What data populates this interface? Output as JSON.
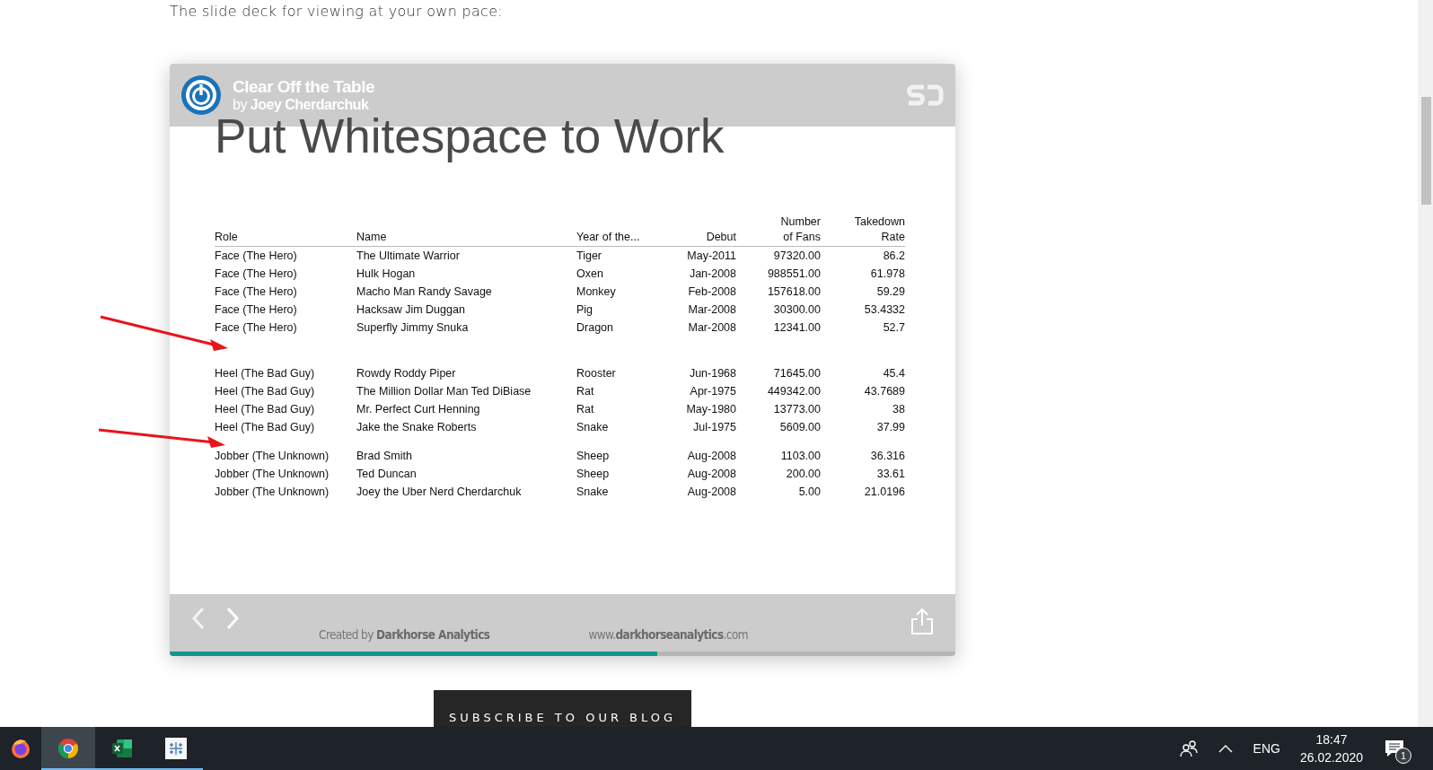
{
  "intro": "The slide deck for viewing at your own pace:",
  "slide_player": {
    "deck_title": "Clear Off the Table",
    "author_prefix": "by",
    "author": "Joey Cherdarchuk",
    "slide": {
      "title": "Put Whitespace to Work",
      "table": {
        "columns": [
          {
            "lines": [
              "Role"
            ],
            "kind": "text"
          },
          {
            "lines": [
              "Name"
            ],
            "kind": "text"
          },
          {
            "lines": [
              "Year of the..."
            ],
            "kind": "text"
          },
          {
            "lines": [
              "Debut"
            ],
            "kind": "number"
          },
          {
            "lines": [
              "Number",
              "of Fans"
            ],
            "kind": "number"
          },
          {
            "lines": [
              "Takedown",
              "Rate"
            ],
            "kind": "number"
          }
        ],
        "groups": [
          {
            "rows": [
              [
                "Face (The Hero)",
                "The Ultimate Warrior",
                "Tiger",
                "May-2011",
                "97320.00",
                "86.2"
              ],
              [
                "Face (The Hero)",
                "Hulk Hogan",
                "Oxen",
                "Jan-2008",
                "988551.00",
                "61.978"
              ],
              [
                "Face (The Hero)",
                "Macho Man Randy Savage",
                "Monkey",
                "Feb-2008",
                "157618.00",
                "59.29"
              ],
              [
                "Face (The Hero)",
                "Hacksaw Jim Duggan",
                "Pig",
                "Mar-2008",
                "30300.00",
                "53.4332"
              ],
              [
                "Face (The Hero)",
                "Superfly Jimmy Snuka",
                "Dragon",
                "Mar-2008",
                "12341.00",
                "52.7"
              ]
            ]
          },
          {
            "rows": [
              [
                "Heel (The Bad Guy)",
                "Rowdy Roddy Piper",
                "Rooster",
                "Jun-1968",
                "71645.00",
                "45.4"
              ],
              [
                "Heel (The Bad Guy)",
                "The Million Dollar Man Ted DiBiase",
                "Rat",
                "Apr-1975",
                "449342.00",
                "43.7689"
              ],
              [
                "Heel (The Bad Guy)",
                "Mr. Perfect Curt Henning",
                "Rat",
                "May-1980",
                "13773.00",
                "38"
              ],
              [
                "Heel (The Bad Guy)",
                "Jake the Snake Roberts",
                "Snake",
                "Jul-1975",
                "5609.00",
                "37.99"
              ]
            ]
          },
          {
            "rows": [
              [
                "Jobber (The Unknown)",
                "Brad Smith",
                "Sheep",
                "Aug-2008",
                "1103.00",
                "36.316"
              ],
              [
                "Jobber (The Unknown)",
                "Ted Duncan",
                "Sheep",
                "Aug-2008",
                "200.00",
                "33.61"
              ],
              [
                "Jobber (The Unknown)",
                "Joey the Uber Nerd Cherdarchuk",
                "Snake",
                "Aug-2008",
                "5.00",
                "21.0196"
              ]
            ]
          }
        ]
      }
    },
    "footer": {
      "created_prefix": "Created by",
      "created_by": "Darkhorse Analytics",
      "url_prefix": "www.",
      "url_domain": "darkhorseanalytics",
      "url_suffix": ".com"
    },
    "progress": {
      "level": 0.62
    }
  },
  "subscribe_button": "SUBSCRIBE TO OUR BLOG",
  "taskbar": {
    "apps": [
      {
        "kind": "firefox",
        "selected": false,
        "open": false
      },
      {
        "kind": "chrome",
        "selected": true,
        "open": true
      },
      {
        "kind": "excel",
        "selected": false,
        "open": true
      },
      {
        "kind": "tableau",
        "selected": false,
        "open": true
      }
    ],
    "language": "ENG",
    "time": "18:47",
    "date": "26.02.2020",
    "notifications": "1"
  }
}
